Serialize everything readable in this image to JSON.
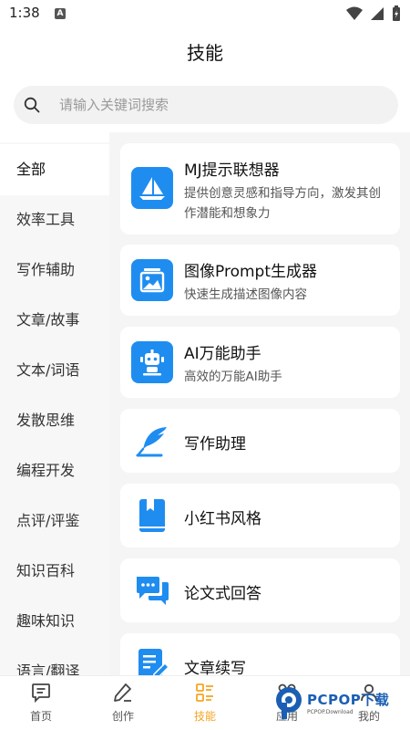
{
  "status": {
    "time": "1:38",
    "notification_letter": "A"
  },
  "header": {
    "title": "技能"
  },
  "search": {
    "placeholder": "请输入关键词搜索"
  },
  "sidebar": {
    "items": [
      {
        "label": "全部",
        "active": true
      },
      {
        "label": "效率工具"
      },
      {
        "label": "写作辅助"
      },
      {
        "label": "文章/故事"
      },
      {
        "label": "文本/词语"
      },
      {
        "label": "发散思维"
      },
      {
        "label": "编程开发"
      },
      {
        "label": "点评/评鉴"
      },
      {
        "label": "知识百科"
      },
      {
        "label": "趣味知识"
      },
      {
        "label": "语言/翻译"
      }
    ]
  },
  "skills": [
    {
      "title": "MJ提示联想器",
      "desc": "提供创意灵感和指导方向，激发其创作潜能和想象力",
      "icon": "sailboat-icon"
    },
    {
      "title": "图像Prompt生成器",
      "desc": "快速生成描述图像内容",
      "icon": "image-gallery-icon"
    },
    {
      "title": "AI万能助手",
      "desc": "高效的万能AI助手",
      "icon": "robot-icon"
    },
    {
      "title": "写作助理",
      "desc": "",
      "icon": "quill-pen-icon"
    },
    {
      "title": "小红书风格",
      "desc": "",
      "icon": "book-icon"
    },
    {
      "title": "论文式回答",
      "desc": "",
      "icon": "chat-bubbles-icon"
    },
    {
      "title": "文章续写",
      "desc": "",
      "icon": "document-edit-icon"
    }
  ],
  "bottom_nav": [
    {
      "label": "首页",
      "icon": "home-message-icon"
    },
    {
      "label": "创作",
      "icon": "pen-icon"
    },
    {
      "label": "技能",
      "icon": "skills-list-icon",
      "active": true
    },
    {
      "label": "应用",
      "icon": "apps-icon"
    },
    {
      "label": "我的",
      "icon": "profile-icon"
    }
  ],
  "watermark": {
    "brand": "PCPOP下载",
    "sub": "PCPOP.Download"
  },
  "colors": {
    "accent_blue": "#1f8df0",
    "active_tab": "#f5a623",
    "sidebar_bg": "#f7f7f7",
    "content_bg": "#f5f5f5"
  }
}
